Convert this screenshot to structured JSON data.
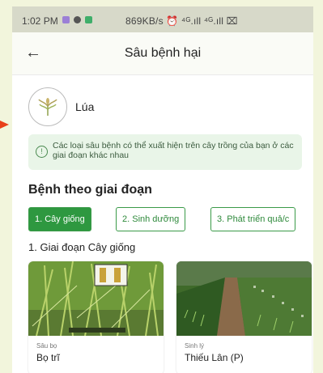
{
  "status_bar": {
    "time": "1:02 PM",
    "network": "869KB/s ⏰ ⁴ᴳ.ıll ⁴ᴳ.ıll ⌧"
  },
  "app_bar": {
    "title": "Sâu bệnh hại"
  },
  "crop": {
    "name": "Lúa"
  },
  "info": {
    "text": "Các loại sâu bệnh có thể xuất hiện trên cây trồng của bạn ở các giai đoạn khác nhau"
  },
  "section": {
    "title": "Bệnh theo giai đoạn"
  },
  "tabs": [
    {
      "label": "1. Cây giống",
      "active": true
    },
    {
      "label": "2. Sinh dưỡng",
      "active": false
    },
    {
      "label": "3. Phát triển quả/c",
      "active": false
    }
  ],
  "stage_title": "1. Giai đoạn Cây giống",
  "cards": [
    {
      "category": "Sâu bọ",
      "name": "Bọ trĩ"
    },
    {
      "category": "Sinh lý",
      "name": "Thiếu Lân (P)"
    }
  ],
  "colors": {
    "accent": "#2e9840",
    "info_bg": "#e9f5e8",
    "pointer": "#e8401a"
  }
}
